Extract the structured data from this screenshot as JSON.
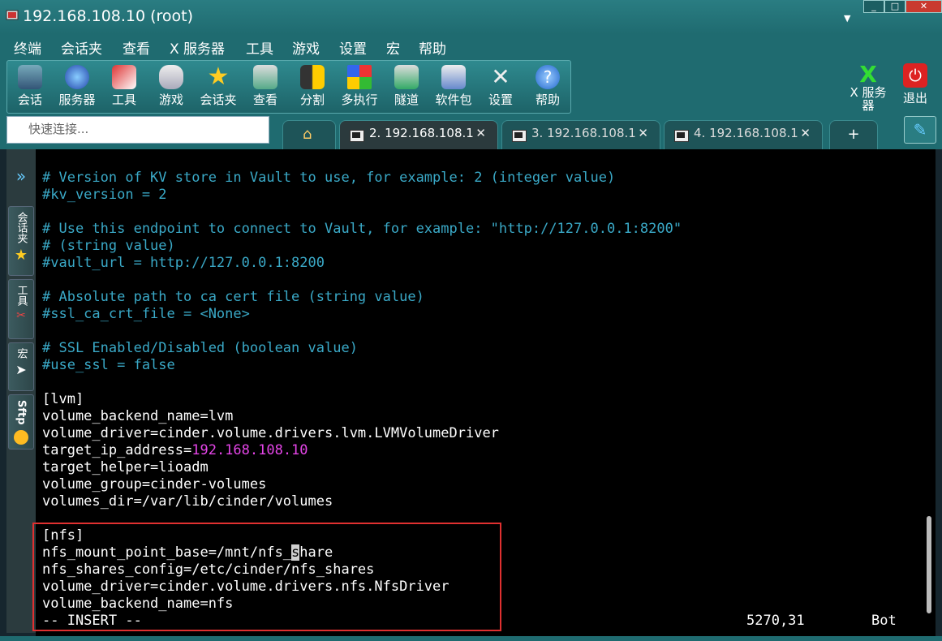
{
  "window": {
    "title": "192.168.108.10 (root)",
    "controls": [
      "_",
      "□",
      "✕"
    ]
  },
  "menu": [
    "终端",
    "会话夹",
    "查看",
    "X 服务器",
    "工具",
    "游戏",
    "设置",
    "宏",
    "帮助"
  ],
  "toolbar": {
    "items": [
      {
        "label": "会话",
        "icon": "session-icon"
      },
      {
        "label": "服务器",
        "icon": "globe-icon"
      },
      {
        "label": "工具",
        "icon": "tools-icon"
      },
      {
        "label": "游戏",
        "icon": "gamepad-icon"
      },
      {
        "label": "会话夹",
        "icon": "star-icon"
      },
      {
        "label": "查看",
        "icon": "monitor-icon"
      },
      {
        "label": "分割",
        "icon": "split-icon"
      },
      {
        "label": "多执行",
        "icon": "multiexec-icon"
      },
      {
        "label": "隧道",
        "icon": "tunnel-icon"
      },
      {
        "label": "软件包",
        "icon": "packages-icon"
      },
      {
        "label": "设置",
        "icon": "wrench-icon"
      },
      {
        "label": "帮助",
        "icon": "help-icon"
      }
    ],
    "xserver_label": "X 服务器",
    "exit_label": "退出"
  },
  "quick_connect": {
    "placeholder": "快速连接..."
  },
  "tabs": [
    {
      "label": "2. 192.168.108.1",
      "active": true
    },
    {
      "label": "3. 192.168.108.1",
      "active": false
    },
    {
      "label": "4. 192.168.108.1",
      "active": false
    }
  ],
  "sidebar": {
    "expand": "»",
    "items": [
      "会话夹",
      "工具",
      "宏",
      "Sftp"
    ]
  },
  "terminal": {
    "lines": [
      {
        "text": "# Version of KV store in Vault to use, for example: 2 (integer value)",
        "style": "comment"
      },
      {
        "text": "#kv_version = 2",
        "style": "comment"
      },
      {
        "text": "",
        "style": "plain"
      },
      {
        "text": "# Use this endpoint to connect to Vault, for example: \"http://127.0.0.1:8200\"",
        "style": "comment"
      },
      {
        "text": "# (string value)",
        "style": "comment"
      },
      {
        "text": "#vault_url = http://127.0.0.1:8200",
        "style": "comment"
      },
      {
        "text": "",
        "style": "plain"
      },
      {
        "text": "# Absolute path to ca cert file (string value)",
        "style": "comment"
      },
      {
        "text": "#ssl_ca_crt_file = <None>",
        "style": "comment"
      },
      {
        "text": "",
        "style": "plain"
      },
      {
        "text": "# SSL Enabled/Disabled (boolean value)",
        "style": "comment"
      },
      {
        "text": "#use_ssl = false",
        "style": "comment"
      },
      {
        "text": "",
        "style": "plain"
      },
      {
        "text": "[lvm]",
        "style": "plain"
      },
      {
        "text": "volume_backend_name=lvm",
        "style": "plain"
      },
      {
        "text": "volume_driver=cinder.volume.drivers.lvm.LVMVolumeDriver",
        "style": "plain"
      },
      {
        "text": "target_ip_address=",
        "style": "plain",
        "ip": "192.168.108.10"
      },
      {
        "text": "target_helper=lioadm",
        "style": "plain"
      },
      {
        "text": "volume_group=cinder-volumes",
        "style": "plain"
      },
      {
        "text": "volumes_dir=/var/lib/cinder/volumes",
        "style": "plain"
      },
      {
        "text": "",
        "style": "plain"
      },
      {
        "text": "[nfs]",
        "style": "plain"
      },
      {
        "text": "nfs_mount_point_base=/mnt/nfs_",
        "style": "plain",
        "cursor": "s",
        "after": "hare"
      },
      {
        "text": "nfs_shares_config=/etc/cinder/nfs_shares",
        "style": "plain"
      },
      {
        "text": "volume_driver=cinder.volume.drivers.nfs.NfsDriver",
        "style": "plain"
      },
      {
        "text": "volume_backend_name=nfs",
        "style": "plain"
      },
      {
        "text": "-- INSERT --",
        "style": "plain"
      }
    ],
    "status_position": "5270,31",
    "status_percent": "Bot"
  },
  "colors": {
    "chrome": "#1f6b70",
    "comment": "#3aa9c7",
    "ip": "#e545e8",
    "highlight_box": "#e03030"
  }
}
